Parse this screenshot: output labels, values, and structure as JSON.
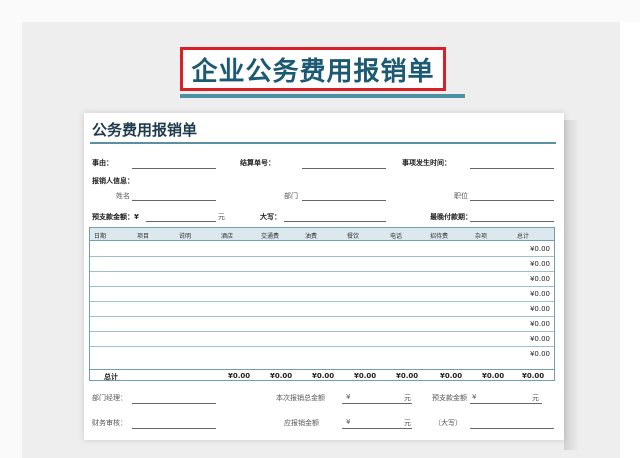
{
  "banner": {
    "title": "企业公务费用报销单"
  },
  "sheet": {
    "title": "公务费用报销单",
    "fields": {
      "reason": "事由：",
      "settle_no": "结算单号：",
      "event_time": "事项发生时间：",
      "applicant_info": "报销人信息：",
      "name": "姓名",
      "dept": "部门",
      "position": "职位",
      "advance_amount": "预支款金额：¥",
      "yuan": "元",
      "uppercase": "大写：",
      "latest_pay_date": "最晚付款期："
    },
    "table": {
      "headers": [
        "日期",
        "项目",
        "说明",
        "酒店",
        "交通费",
        "油费",
        "餐饮",
        "电话",
        "招待费",
        "杂项",
        "总计"
      ],
      "row_totals": [
        "¥0.00",
        "¥0.00",
        "¥0.00",
        "¥0.00",
        "¥0.00",
        "¥0.00",
        "¥0.00",
        "¥0.00"
      ],
      "total_label": "总计",
      "column_totals": [
        "¥0.00",
        "¥0.00",
        "¥0.00",
        "¥0.00",
        "¥0.00",
        "¥0.00",
        "¥0.00",
        "¥0.00"
      ]
    },
    "footer": {
      "dept_manager": "部门经理：",
      "this_total": "本次报销总金额",
      "yen1": "¥",
      "yuan1": "元",
      "advance": "预支款金额",
      "yen2": "¥",
      "yuan2": "元",
      "finance": "财务审核：",
      "due": "应报销金额",
      "yen3": "¥",
      "yuan3": "元",
      "uppercase": "（大写）"
    }
  }
}
